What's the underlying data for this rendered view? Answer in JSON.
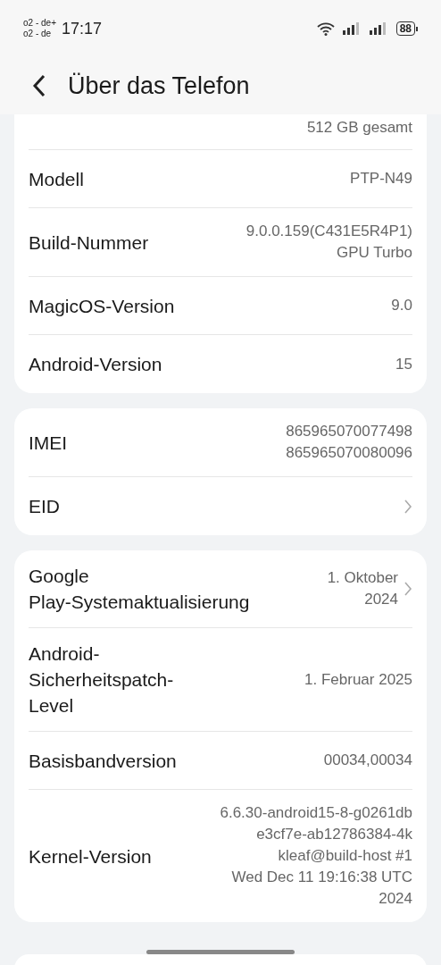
{
  "status_bar": {
    "carrier_lines": [
      "o2 - de+",
      "o2 - de"
    ],
    "time": "17:17",
    "battery": "88"
  },
  "header": {
    "title": "Über das Telefon"
  },
  "cards": [
    {
      "rows": [
        {
          "kind": "info",
          "value": "512  GB gesamt"
        },
        {
          "kind": "info",
          "label": "Modell",
          "value": "PTP-N49"
        },
        {
          "kind": "info",
          "label": "Build-Nummer",
          "value": "9.0.0.159(C431E5R4P1)\nGPU Turbo"
        },
        {
          "kind": "info",
          "label": "MagicOS-Version",
          "value": "9.0"
        },
        {
          "kind": "info",
          "label": "Android-Version",
          "value": "15"
        }
      ]
    },
    {
      "rows": [
        {
          "kind": "info",
          "label": "IMEI",
          "value": "865965070077498\n865965070080096"
        },
        {
          "kind": "link",
          "label": "EID"
        }
      ]
    },
    {
      "rows": [
        {
          "kind": "link",
          "label": "Google\nPlay-Systemaktualisierung",
          "value": "1. Oktober\n2024"
        },
        {
          "kind": "info",
          "label": "Android-\nSicherheitspatch-\nLevel",
          "value": "1. Februar 2025"
        },
        {
          "kind": "info",
          "label": "Basisbandversion",
          "value": "00034,00034"
        },
        {
          "kind": "info",
          "label": "Kernel-Version",
          "value": "6.6.30-android15-8-g0261db\ne3cf7e-ab12786384-4k\nkleaf@build-host #1\nWed Dec 11 19:16:38 UTC\n2024"
        }
      ]
    }
  ]
}
